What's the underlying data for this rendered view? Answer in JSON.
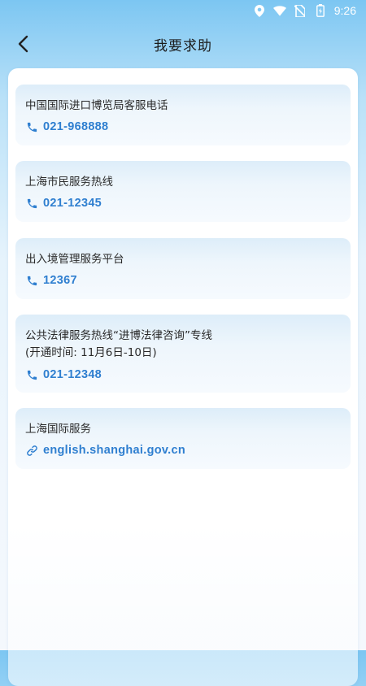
{
  "status_bar": {
    "time": "9:26",
    "icons": [
      "location-icon",
      "wifi-icon",
      "no-sim-icon",
      "battery-icon"
    ]
  },
  "header": {
    "back_icon": "chevron-left-icon",
    "title": "我要求助"
  },
  "colors": {
    "accent": "#2f7fd0",
    "title_text": "#1b1b1b",
    "card_text": "#2a2a2a"
  },
  "cards": [
    {
      "title": "中国国际进口博览局客服电话",
      "note": "",
      "contact_icon": "phone-icon",
      "contact": "021-968888"
    },
    {
      "title": "上海市民服务热线",
      "note": "",
      "contact_icon": "phone-icon",
      "contact": "021-12345"
    },
    {
      "title": "出入境管理服务平台",
      "note": "",
      "contact_icon": "phone-icon",
      "contact": "12367"
    },
    {
      "title": "公共法律服务热线“进博法律咨询”专线",
      "note": "(开通时间: 11月6日-10日)",
      "contact_icon": "phone-icon",
      "contact": "021-12348"
    },
    {
      "title": "上海国际服务",
      "note": "",
      "contact_icon": "link-icon",
      "contact": "english.shanghai.gov.cn"
    }
  ]
}
